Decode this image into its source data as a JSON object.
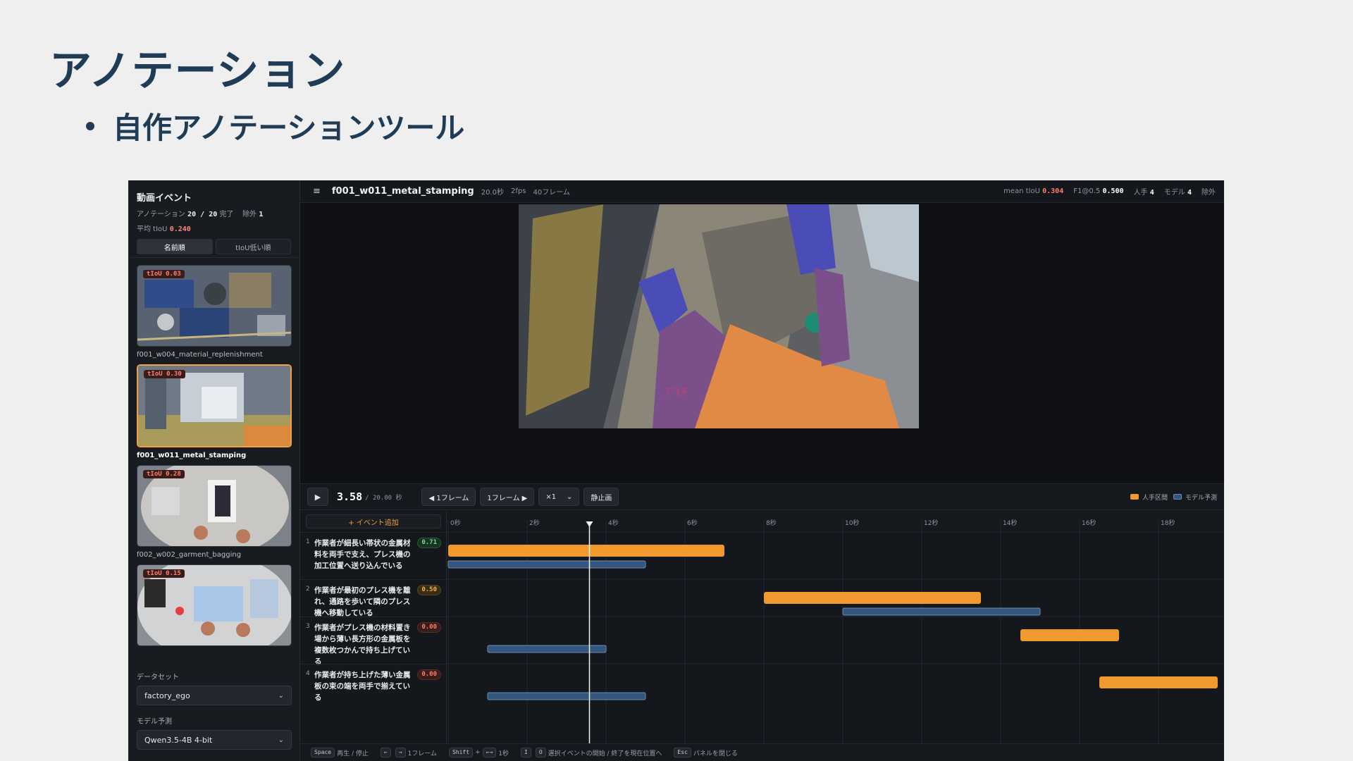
{
  "slide": {
    "title": "アノテーション",
    "bullet": "自作アノテーションツール"
  },
  "sidebar": {
    "title": "動画イベント",
    "progress_label": "アノテーション",
    "progress_value": "20 / 20",
    "progress_suffix": "完了",
    "excluded_label": "除外",
    "excluded_value": "1",
    "avg_label": "平均 tIoU",
    "avg_value": "0.240",
    "sort_name": "名前順",
    "sort_tiou": "tIoU低い順",
    "items": [
      {
        "badge": "tIoU 0.03",
        "label": "f001_w004_material_replenishment"
      },
      {
        "badge": "tIoU 0.30",
        "label": "f001_w011_metal_stamping"
      },
      {
        "badge": "tIoU 0.28",
        "label": "f002_w002_garment_bagging"
      },
      {
        "badge": "tIoU 0.15",
        "label": ""
      }
    ],
    "dataset_label": "データセット",
    "dataset_value": "factory_ego",
    "model_label": "モデル予測",
    "model_value": "Qwen3.5-4B 4-bit"
  },
  "topbar": {
    "menu_icon": "≡",
    "filename": "f001_w011_metal_stamping",
    "duration": "20.0秒",
    "fps": "2fps",
    "frames": "40フレーム",
    "mean_label": "mean tIoU",
    "mean_value": "0.304",
    "f1_label": "F1@0.5",
    "f1_value": "0.500",
    "human_label": "人手",
    "human_value": "4",
    "model_label": "モデル",
    "model_value": "4",
    "exclude_label": "除外"
  },
  "controls": {
    "current_time": "3.58",
    "total_time": "/ 20.00 秒",
    "prev_frame": "◀ 1フレーム",
    "next_frame": "1フレーム ▶",
    "speed": "×1",
    "still": "静止画",
    "legend_human": "人手区間",
    "legend_model": "モデル予測"
  },
  "timeline": {
    "add_event": "+ イベント追加",
    "events": [
      {
        "num": "1",
        "text": "作業者が細長い帯状の金属材料を両手で支え、プレス機の加工位置へ送り込んでいる",
        "score": "0.71",
        "level": "green"
      },
      {
        "num": "2",
        "text": "作業者が最初のプレス機を離れ、通路を歩いて隣のプレス機へ移動している",
        "score": "0.50",
        "level": "yellow"
      },
      {
        "num": "3",
        "text": "作業者がプレス機の材料置き場から薄い長方形の金属板を複数枚つかんで持ち上げている",
        "score": "0.00",
        "level": "red"
      },
      {
        "num": "4",
        "text": "作業者が持ち上げた薄い金属板の束の端を両手で揃えている",
        "score": "0.00",
        "level": "red"
      }
    ]
  },
  "chart_data": {
    "type": "timeline",
    "x_unit": "秒",
    "xlim": [
      0,
      20
    ],
    "ticks": [
      "0秒",
      "2秒",
      "4秒",
      "6秒",
      "8秒",
      "10秒",
      "12秒",
      "14秒",
      "16秒",
      "18秒"
    ],
    "playhead": 3.58,
    "series": [
      {
        "name": "人手区間",
        "color": "#f0992e",
        "intervals": [
          [
            0.0,
            7.0
          ],
          [
            8.0,
            13.5
          ],
          [
            14.5,
            17.0
          ],
          [
            16.5,
            19.5
          ]
        ]
      },
      {
        "name": "モデル予測",
        "color": "#34567e",
        "intervals": [
          [
            0.0,
            5.0
          ],
          [
            10.0,
            15.0
          ],
          [
            1.0,
            4.0
          ],
          [
            1.0,
            5.0
          ]
        ]
      }
    ]
  },
  "hints": {
    "space_key": "Space",
    "space_text": "再生 / 停止",
    "arrow_left": "←",
    "arrow_right": "→",
    "arrow_text": "1フレーム",
    "shift_key": "Shift",
    "shift_plus": "+",
    "shift_arrow": "←→",
    "shift_text": "1秒",
    "i_key": "I",
    "o_key": "O",
    "io_text": "選択イベントの開始 / 終了を現在位置へ",
    "esc_key": "Esc",
    "esc_text": "パネルを閉じる"
  },
  "colors": {
    "accent_orange": "#f0992e",
    "model_blue": "#34567e",
    "selected_border": "#f0a03c"
  }
}
